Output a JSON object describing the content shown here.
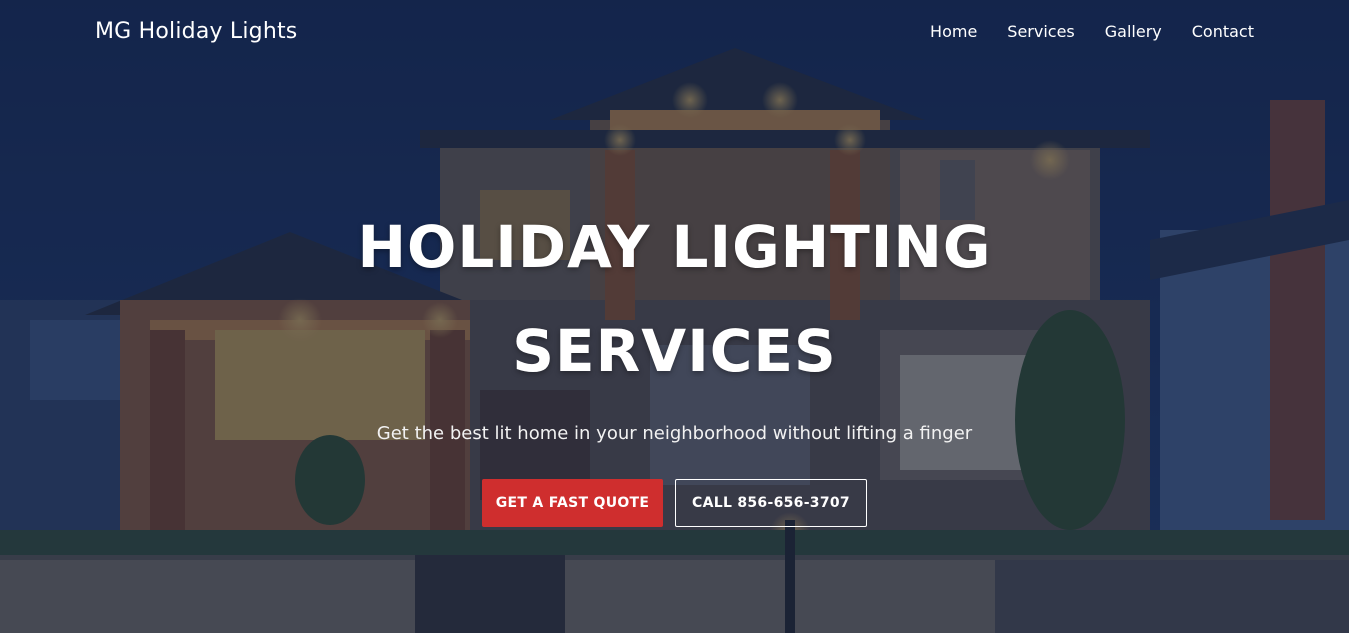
{
  "header": {
    "brand": "MG Holiday Lights",
    "nav": [
      "Home",
      "Services",
      "Gallery",
      "Contact"
    ]
  },
  "hero": {
    "title_line1": "HOLIDAY LIGHTING",
    "title_line2": "SERVICES",
    "subtitle": "Get the best lit home in your neighborhood without lifting a finger",
    "quote_button": "GET A FAST QUOTE",
    "call_button": "CALL 856-656-3707"
  },
  "colors": {
    "accent": "#cf2e2e",
    "overlay": "#0e1e3e",
    "text": "#ffffff"
  }
}
